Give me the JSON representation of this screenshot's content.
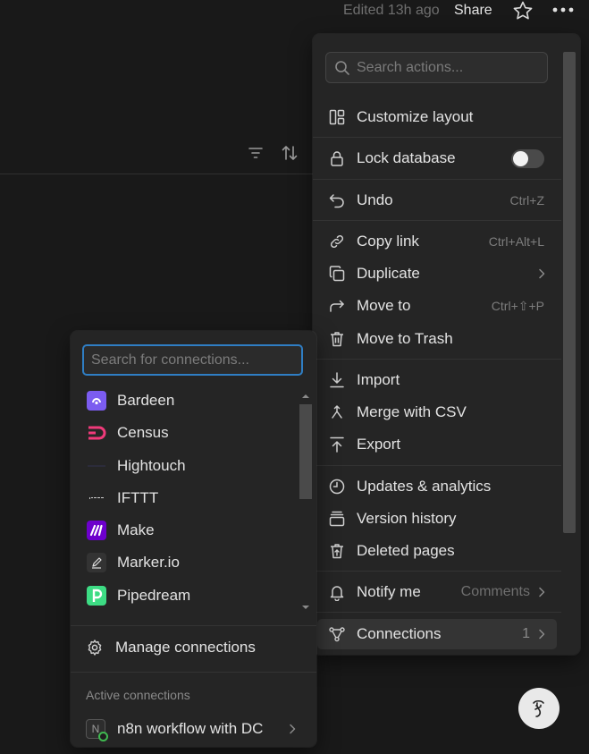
{
  "topbar": {
    "edited_text": "Edited 13h ago",
    "share_label": "Share",
    "favorite_icon": "star-icon",
    "more_icon": "more-horizontal-icon"
  },
  "toolbar": {
    "filter_icon": "filter-icon",
    "sort_icon": "sort-icon"
  },
  "actions_menu": {
    "search": {
      "placeholder": "Search actions..."
    },
    "items": [
      {
        "label": "Customize layout",
        "icon": "layout-icon"
      },
      {
        "label": "Lock database",
        "icon": "lock-icon",
        "toggle": false
      },
      {
        "label": "Undo",
        "icon": "undo-icon",
        "shortcut": "Ctrl+Z"
      },
      {
        "label": "Copy link",
        "icon": "link-icon",
        "shortcut": "Ctrl+Alt+L"
      },
      {
        "label": "Duplicate",
        "icon": "duplicate-icon"
      },
      {
        "label": "Move to",
        "icon": "move-to-icon",
        "shortcut": "Ctrl+⇧+P"
      },
      {
        "label": "Move to Trash",
        "icon": "trash-icon"
      },
      {
        "label": "Import",
        "icon": "import-icon"
      },
      {
        "label": "Merge with CSV",
        "icon": "merge-icon"
      },
      {
        "label": "Export",
        "icon": "export-icon"
      },
      {
        "label": "Updates & analytics",
        "icon": "clock-icon"
      },
      {
        "label": "Version history",
        "icon": "version-history-icon"
      },
      {
        "label": "Deleted pages",
        "icon": "deleted-pages-icon"
      },
      {
        "label": "Notify me",
        "icon": "bell-icon",
        "value": "Comments"
      },
      {
        "label": "Connections",
        "icon": "connections-icon",
        "count": "1"
      }
    ]
  },
  "connections_menu": {
    "search": {
      "placeholder": "Search for connections..."
    },
    "items": [
      {
        "label": "Bardeen",
        "icon": "bardeen-logo-icon",
        "color": "#7b5cf0"
      },
      {
        "label": "Census",
        "icon": "census-logo-icon",
        "color": "#f03a7a"
      },
      {
        "label": "Hightouch",
        "icon": "hightouch-logo-icon",
        "color": "#2b2b3a"
      },
      {
        "label": "IFTTT",
        "icon": "ifttt-logo-icon",
        "color": "#222222"
      },
      {
        "label": "Make",
        "icon": "make-logo-icon",
        "color": "#6d00cc"
      },
      {
        "label": "Marker.io",
        "icon": "marker-io-logo-icon",
        "color": "#333333"
      },
      {
        "label": "Pipedream",
        "icon": "pipedream-logo-icon",
        "color": "#3ddc84"
      }
    ],
    "manage_label": "Manage connections",
    "active_header": "Active connections",
    "active": [
      {
        "label": "n8n workflow with DC",
        "logo_letter": "N",
        "status_color": "#3fb950"
      }
    ]
  },
  "help_icon": "help-icon"
}
